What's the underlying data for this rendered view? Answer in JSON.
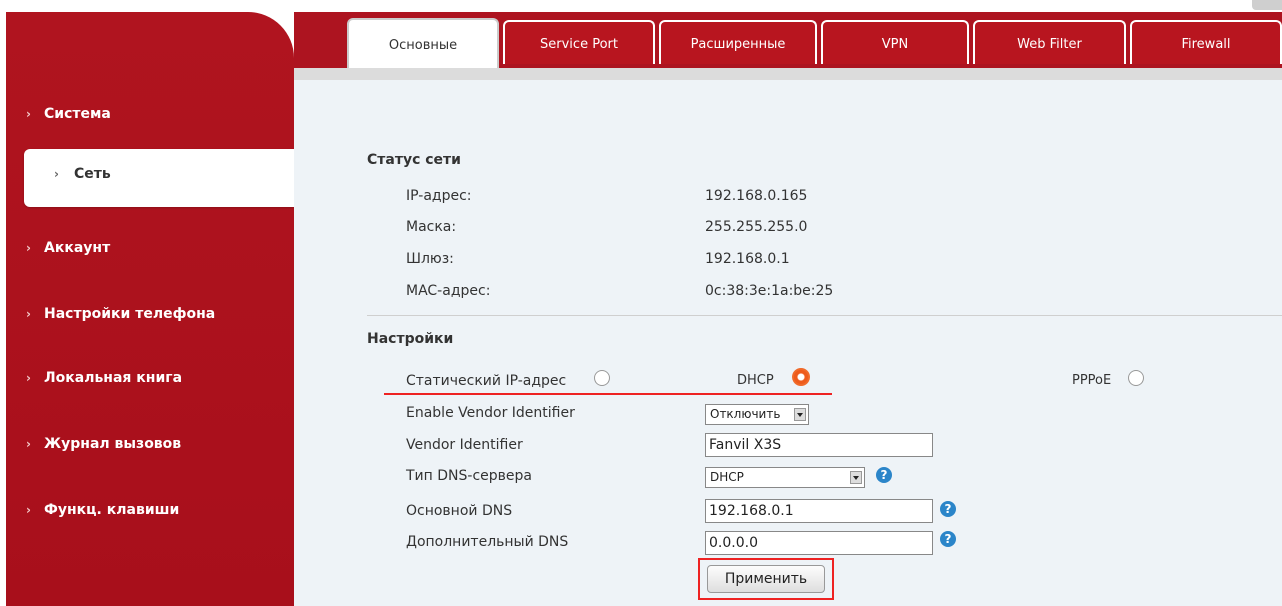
{
  "sidebar": {
    "items": [
      {
        "label": "Система"
      },
      {
        "label": "Сеть"
      },
      {
        "label": "Аккаунт"
      },
      {
        "label": "Настройки телефона"
      },
      {
        "label": "Локальная книга"
      },
      {
        "label": "Журнал вызовов"
      },
      {
        "label": "Функц. клавиши"
      }
    ],
    "active": "Сеть"
  },
  "tabs": [
    {
      "label": "Основные",
      "active": true
    },
    {
      "label": "Service Port"
    },
    {
      "label": "Расширенные"
    },
    {
      "label": "VPN"
    },
    {
      "label": "Web Filter"
    },
    {
      "label": "Firewall"
    }
  ],
  "status": {
    "title": "Статус сети",
    "rows": [
      {
        "label": "IP-адрес:",
        "value": "192.168.0.165"
      },
      {
        "label": "Маска:",
        "value": "255.255.255.0"
      },
      {
        "label": "Шлюз:",
        "value": "192.168.0.1"
      },
      {
        "label": "MAC-адрес:",
        "value": "0c:38:3e:1a:be:25"
      }
    ]
  },
  "settings": {
    "title": "Настройки",
    "mode_static": "Статический IP-адрес",
    "mode_dhcp": "DHCP",
    "mode_pppoe": "PPPoE",
    "selected_mode": "DHCP",
    "vendor_enable_label": "Enable Vendor Identifier",
    "vendor_enable_value": "Отключить",
    "vendor_id_label": "Vendor Identifier",
    "vendor_id_value": "Fanvil X3S",
    "dns_type_label": "Тип DNS-сервера",
    "dns_type_value": "DHCP",
    "dns_primary_label": "Основной DNS",
    "dns_primary_value": "192.168.0.1",
    "dns_secondary_label": "Дополнительный DNS",
    "dns_secondary_value": "0.0.0.0",
    "help_glyph": "?",
    "apply_label": "Применить"
  },
  "colors": {
    "brand": "#ad1420",
    "selected_radio": "#ee5b1c",
    "highlight": "#e22222",
    "help": "#2b85c9"
  }
}
